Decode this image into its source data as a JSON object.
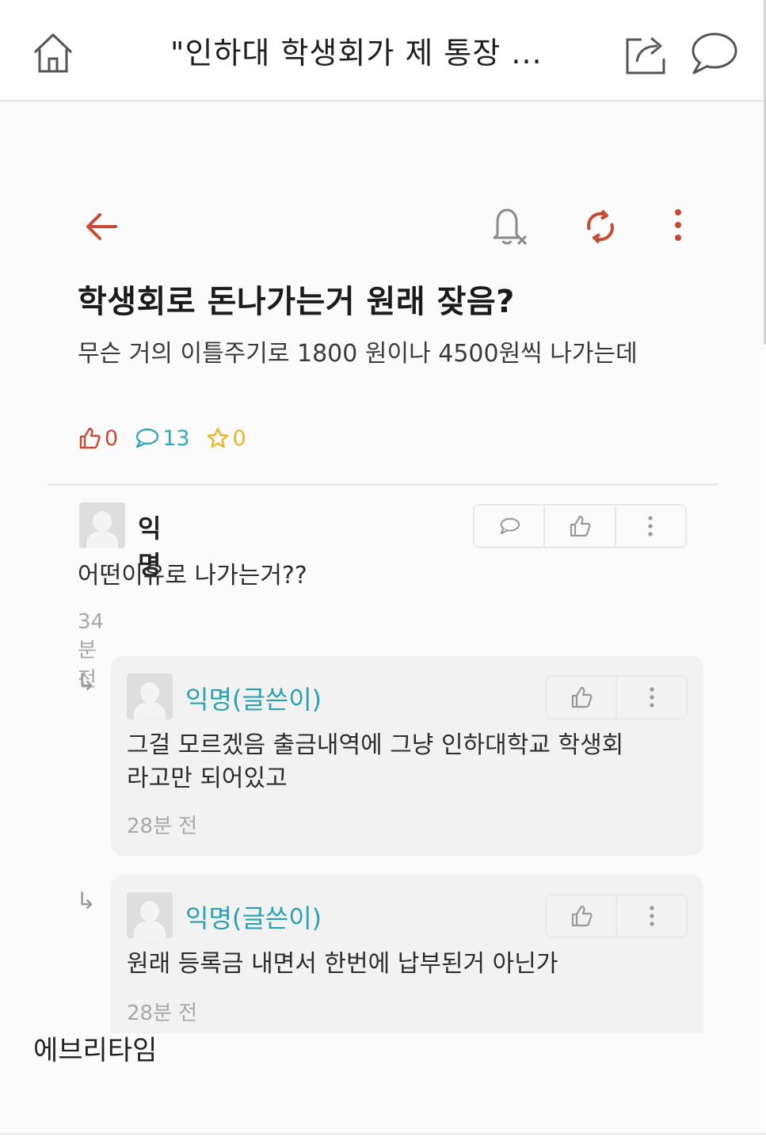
{
  "topbar": {
    "title": "\"인하대 학생회가 제 통장 ...",
    "icons": [
      "home-icon",
      "share-icon",
      "chat-bubble-icon"
    ]
  },
  "post": {
    "title": "학생회로 돈나가는거 원래 잦음?",
    "body": "무슨 거의 이틀주기로 1800 원이나 4500원씩 나가는데",
    "likes": "0",
    "comments": "13",
    "scraps": "0"
  },
  "comments": [
    {
      "author": "익명",
      "text": "어떤이유로 나가는거??",
      "time": "34분 전"
    },
    {
      "author": "익명(글쓴이)",
      "text": "그걸 모르겠음 출금내역에 그냥 인하대학교 학생회라고만 되어있고",
      "time": "28분 전"
    },
    {
      "author": "익명(글쓴이)",
      "text": "원래 등록금 내면서 한번에 납부된거 아닌가",
      "time": "28분 전"
    }
  ],
  "footer": {
    "label": "에브리타임"
  },
  "colors": {
    "accent": "#c64b34",
    "writer": "#2aa1b2",
    "comment_stat": "#39a7b5",
    "scrap_stat": "#e7b52a"
  }
}
